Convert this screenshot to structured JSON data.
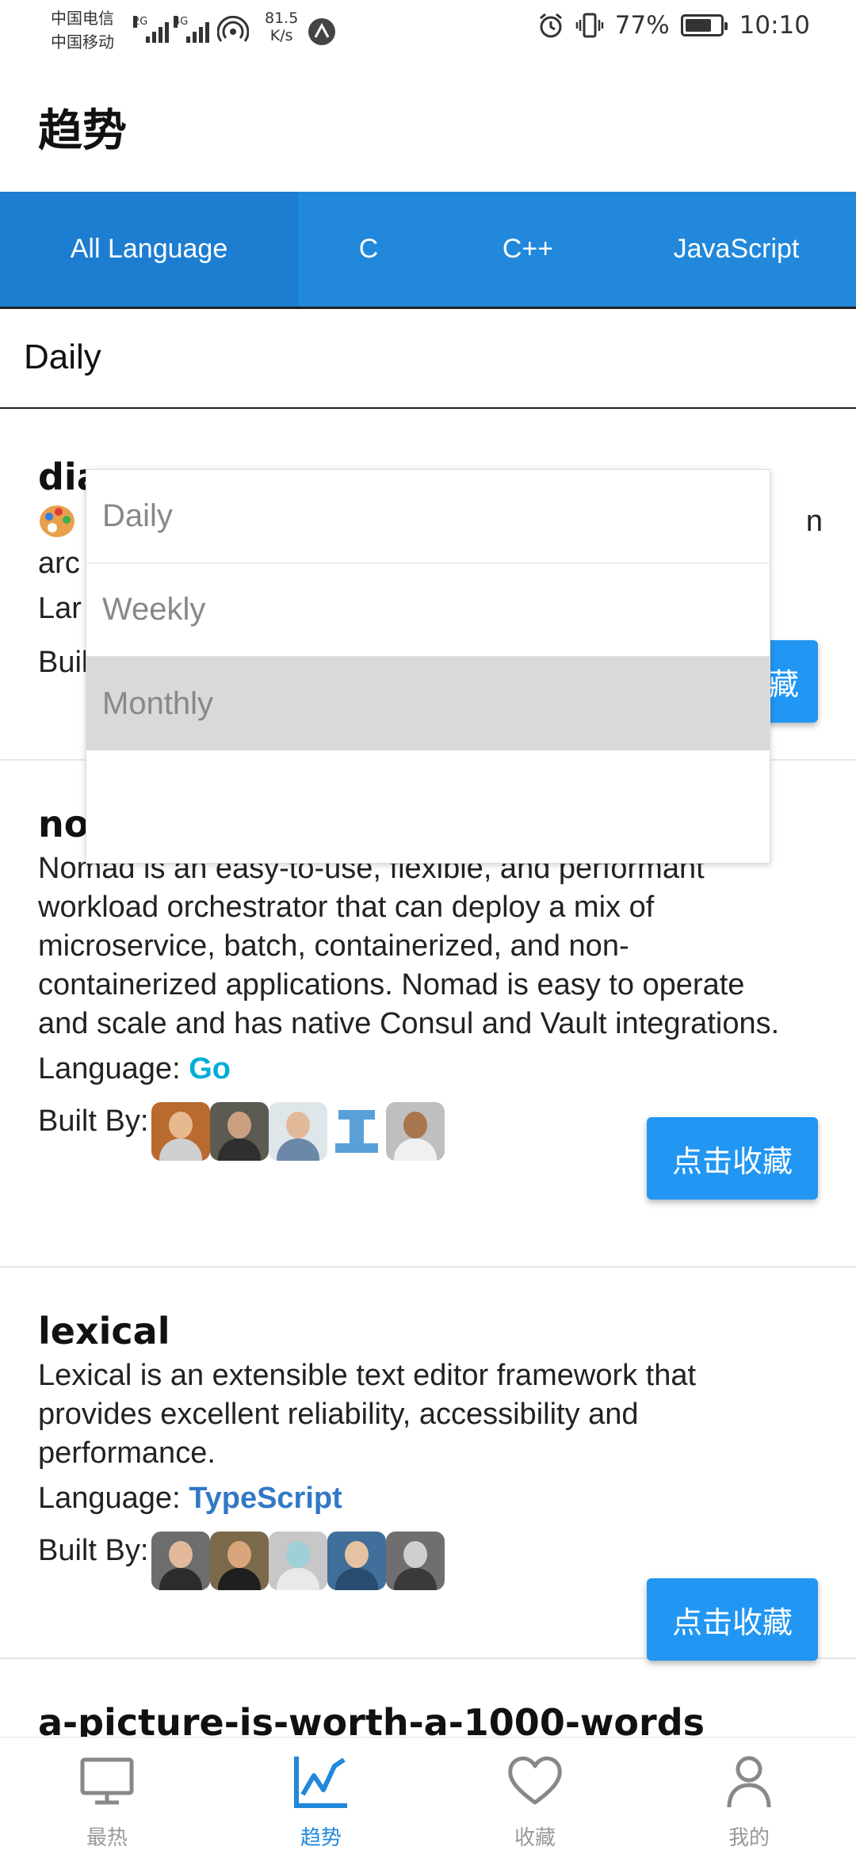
{
  "status_bar": {
    "carrier1": "中国电信",
    "carrier2": "中国移动",
    "net1": "2G",
    "net2": "4G",
    "speed_value": "81.5",
    "speed_unit": "K/s",
    "battery_text": "77%",
    "battery_level": 0.77,
    "time": "10:10"
  },
  "header": {
    "title": "趋势"
  },
  "tabs": [
    {
      "label": "All Language",
      "active": true
    },
    {
      "label": "C"
    },
    {
      "label": "C++"
    },
    {
      "label": "JavaScript"
    }
  ],
  "period": {
    "selected": "Daily",
    "options": [
      "Daily",
      "Weekly",
      "Monthly"
    ],
    "highlighted": "Monthly"
  },
  "repos": [
    {
      "name": "dia",
      "desc_visible_prefix": "arc",
      "lang_prefix_visible": "Lar",
      "built_prefix_visible": "Buil",
      "fav_label_visible": "藏"
    },
    {
      "name": "no",
      "description": "Nomad is an easy-to-use, flexible, and performant workload orchestrator that can deploy a mix of microservice, batch, containerized, and non-containerized applications. Nomad is easy to operate and scale and has native Consul and Vault integrations.",
      "language_label": "Language:",
      "language": "Go",
      "language_color": "#00acd7",
      "built_by_label": "Built By:",
      "fav_label": "点击收藏"
    },
    {
      "name": "lexical",
      "description": "Lexical is an extensible text editor framework that provides excellent reliability, accessibility and performance.",
      "language_label": "Language:",
      "language": "TypeScript",
      "language_color": "#3178c6",
      "built_by_label": "Built By:",
      "fav_label": "点击收藏"
    },
    {
      "name": "a-picture-is-worth-a-1000-words"
    }
  ],
  "bottom_nav": [
    {
      "label": "最热",
      "icon": "monitor-icon"
    },
    {
      "label": "趋势",
      "icon": "trend-chart-icon",
      "active": true
    },
    {
      "label": "收藏",
      "icon": "heart-icon"
    },
    {
      "label": "我的",
      "icon": "person-icon"
    }
  ],
  "colors": {
    "primary": "#2188db",
    "button": "#2196f3"
  }
}
